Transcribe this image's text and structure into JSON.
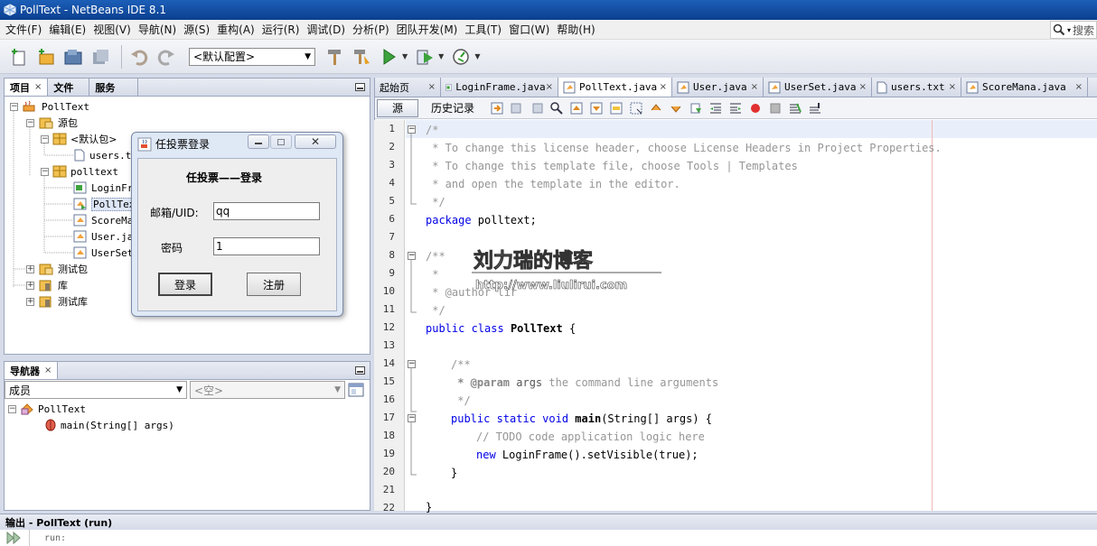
{
  "window": {
    "title": "PollText - NetBeans IDE 8.1"
  },
  "menu": [
    "文件(F)",
    "编辑(E)",
    "视图(V)",
    "导航(N)",
    "源(S)",
    "重构(A)",
    "运行(R)",
    "调试(D)",
    "分析(P)",
    "团队开发(M)",
    "工具(T)",
    "窗口(W)",
    "帮助(H)"
  ],
  "search": {
    "placeholder": "搜索"
  },
  "toolbar": {
    "config": "<默认配置>"
  },
  "project_panel": {
    "tabs": [
      "项目",
      "文件",
      "服务"
    ],
    "tree": [
      {
        "label": "PollText",
        "mono": true
      },
      {
        "label": "源包",
        "mono": false
      },
      {
        "label": "<默认包>",
        "mono": false
      },
      {
        "label": "users.txt",
        "mono": true
      },
      {
        "label": "polltext",
        "mono": true
      },
      {
        "label": "LoginFrame.java",
        "mono": true
      },
      {
        "label": "PollText.java",
        "mono": true
      },
      {
        "label": "ScoreMana.java",
        "mono": true
      },
      {
        "label": "User.java",
        "mono": true
      },
      {
        "label": "UserSet.java",
        "mono": true
      },
      {
        "label": "测试包",
        "mono": false
      },
      {
        "label": "库",
        "mono": false
      },
      {
        "label": "测试库",
        "mono": false
      }
    ]
  },
  "navigator": {
    "title": "导航器",
    "members_label": "成员",
    "filter_label": "<空>",
    "tree": [
      {
        "label": "PollText"
      },
      {
        "label": "main(String[] args)"
      }
    ]
  },
  "editor": {
    "tabs": [
      "起始页",
      "LoginFrame.java",
      "PollText.java",
      "User.java",
      "UserSet.java",
      "users.txt",
      "ScoreMana.java"
    ],
    "active_tab": "PollText.java",
    "source_label": "源",
    "history_label": "历史记录",
    "line_numbers": [
      "1",
      "2",
      "3",
      "4",
      "5",
      "6",
      "7",
      "8",
      "9",
      "10",
      "11",
      "12",
      "13",
      "14",
      "15",
      "16",
      "17",
      "18",
      "19",
      "20",
      "21",
      "22"
    ],
    "code": {
      "l1": "/*",
      "l2": " * To change this license header, choose License Headers in Project Properties.",
      "l3": " * To change this template file, choose Tools | Templates",
      "l4": " * and open the template in the editor.",
      "l5": " */",
      "l6a": "package",
      "l6b": " polltext;",
      "l8": "/**",
      "l9": " *",
      "l10": " * @author lir",
      "l11": " */",
      "l12a": "public class",
      "l12b": "PollText",
      "l12c": " {",
      "l14": "/**",
      "l15a": " * @param",
      "l15b": " args",
      "l15c": " the command line arguments",
      "l16": " */",
      "l17a": "public static void",
      "l17b": "main",
      "l17c": "(String[] args) {",
      "l18": "// TODO code application logic here",
      "l19a": "new",
      "l19b": " LoginFrame().setVisible(true);",
      "l20": "}",
      "l22": "}"
    }
  },
  "output": {
    "title": "输出 - PollText (run)",
    "line1": "run:"
  },
  "dialog": {
    "title": "任投票登录",
    "heading": "任投票——登录",
    "email_label": "邮箱/UID:",
    "email_value": "qq",
    "password_label": "密码",
    "password_value": "1",
    "login_button": "登录",
    "register_button": "注册"
  },
  "watermark": {
    "line1": "刘力瑞的博客",
    "line2": "http://www.liulirui.com"
  }
}
